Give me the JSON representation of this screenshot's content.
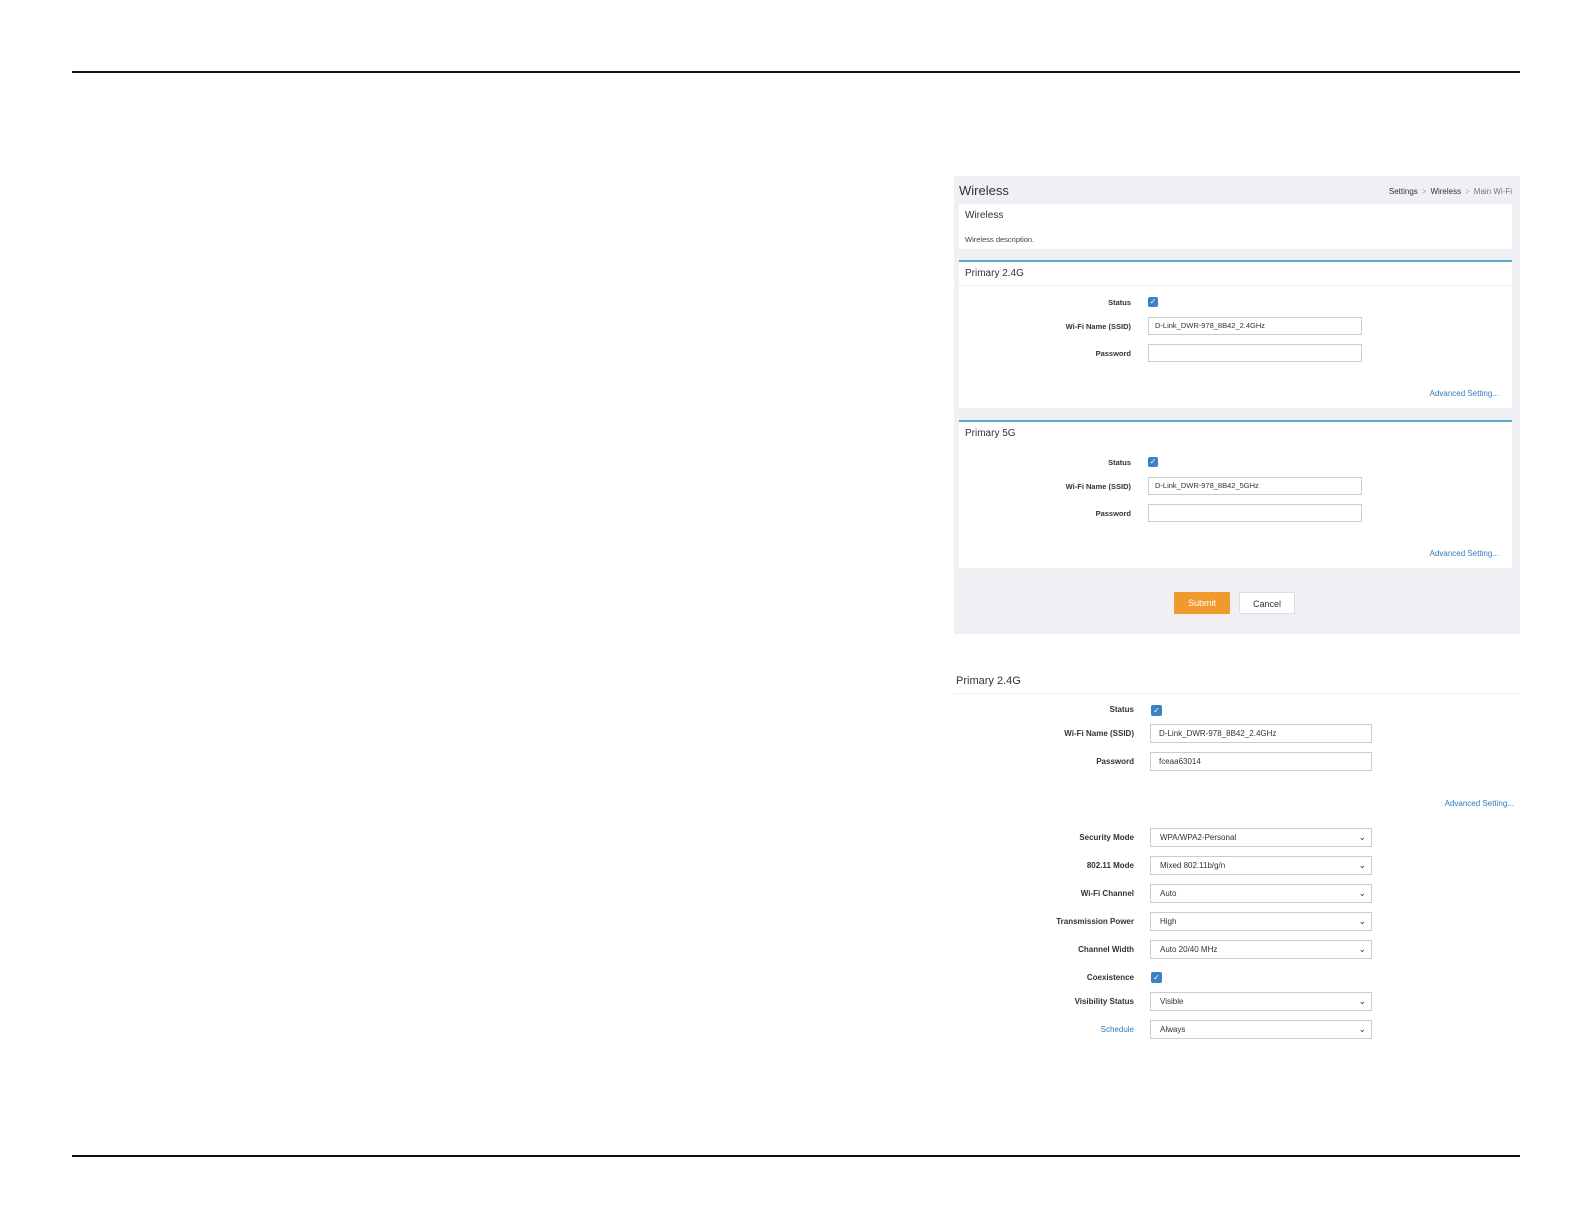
{
  "panel": {
    "title": "Wireless",
    "breadcrumb": [
      "Settings",
      "Wireless",
      "Main Wi-Fi"
    ],
    "info": {
      "heading": "Wireless",
      "description": "Wireless description."
    },
    "primary24": {
      "heading": "Primary 2.4G",
      "status_label": "Status",
      "ssid_label": "Wi-Fi Name (SSID)",
      "ssid_value": "D-Link_DWR-978_8B42_2.4GHz",
      "password_label": "Password",
      "password_value": "",
      "advanced_link": "Advanced Setting..."
    },
    "primary5": {
      "heading": "Primary 5G",
      "status_label": "Status",
      "ssid_label": "Wi-Fi Name (SSID)",
      "ssid_value": "D-Link_DWR-978_8B42_5GHz",
      "password_label": "Password",
      "password_value": "",
      "advanced_link": "Advanced Setting..."
    },
    "submit_label": "Submit",
    "cancel_label": "Cancel"
  },
  "detail": {
    "heading": "Primary 2.4G",
    "status_label": "Status",
    "ssid_label": "Wi-Fi Name (SSID)",
    "ssid_value": "D-Link_DWR-978_8B42_2.4GHz",
    "password_label": "Password",
    "password_value": "fceaa63014",
    "advanced_link": "Advanced Setting...",
    "security_mode": {
      "label": "Security Mode",
      "value": "WPA/WPA2-Personal"
    },
    "mode_80211": {
      "label": "802.11 Mode",
      "value": "Mixed 802.11b/g/n"
    },
    "wifi_channel": {
      "label": "Wi-Fi Channel",
      "value": "Auto"
    },
    "tx_power": {
      "label": "Transmission Power",
      "value": "High"
    },
    "channel_width": {
      "label": "Channel Width",
      "value": "Auto 20/40 MHz"
    },
    "coexistence_label": "Coexistence",
    "visibility": {
      "label": "Visibility Status",
      "value": "Visible"
    },
    "schedule": {
      "label": "Schedule",
      "value": "Always"
    }
  },
  "colors": {
    "accent": "#ef9a2a",
    "checkbox": "#3b82c4",
    "link": "#2f7bbf",
    "section_border": "#5aa6c9"
  },
  "icons": {
    "checkbox": "checkmark-icon",
    "select": "chevron-down-icon"
  }
}
